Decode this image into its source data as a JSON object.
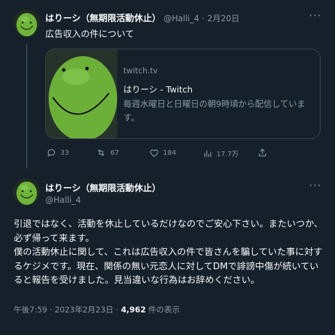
{
  "tweet1": {
    "display_name": "はりーシ（無期限活動休止）",
    "handle": "@Halli_4",
    "separator": "·",
    "date": "2月20日",
    "text": "広告収入の件について",
    "more_label": "···",
    "card": {
      "domain": "twitch.tv",
      "title": "はりーシ - Twitch",
      "description": "毎週水曜日と日曜日の朝9時頃から配信していま\nす。"
    },
    "actions": {
      "replies": "33",
      "retweets": "67",
      "likes": "184",
      "views": "17.7万"
    }
  },
  "tweet2": {
    "display_name": "はりーシ（無期限活動休止）",
    "handle": "@Halli_4",
    "more_label": "···",
    "text": "引退ではなく、活動を休止しているだけなのでご安心下さい。またいつか、必ず帰って来ます。\n僕の活動休止に関して、これは広告収入の件で皆さんを騙していた事に対するケジメです。現在、関係の無い元恋人に対してDMで誹謗中傷が続いていると報告を受けました。見当違いな行為はお辞めください。",
    "time": "午後7:59",
    "separator": "·",
    "date": "2023年2月23日",
    "views_count": "4,962",
    "views_label": "件の表示"
  },
  "colors": {
    "background": "#15202b",
    "text": "#f7f9f9",
    "muted": "#8b98a5",
    "border": "#38444d",
    "avatar_green": "#6fb43a"
  },
  "icons": [
    "blob-avatar",
    "more-icon",
    "reply-icon",
    "retweet-icon",
    "like-icon",
    "views-icon"
  ]
}
